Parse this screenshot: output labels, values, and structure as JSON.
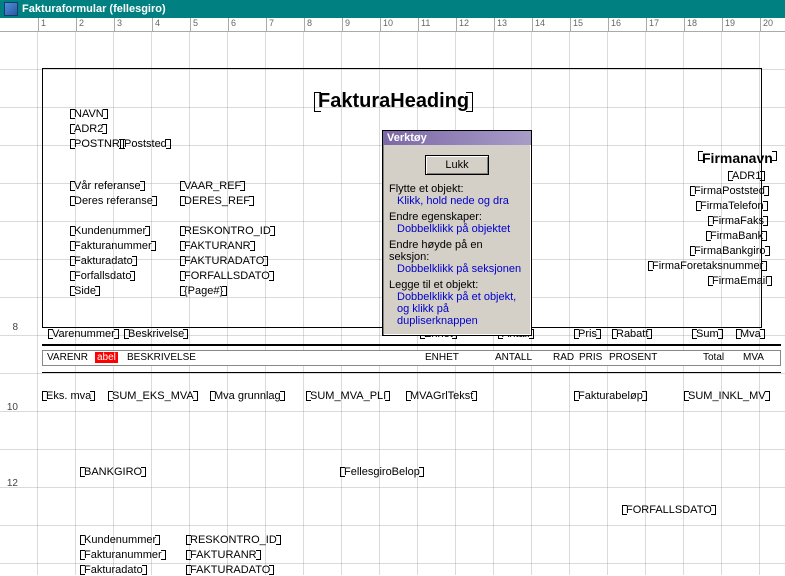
{
  "window": {
    "title": "Fakturaformular (fellesgiro)"
  },
  "ruler": [
    "1",
    "2",
    "3",
    "4",
    "5",
    "6",
    "7",
    "8",
    "9",
    "10",
    "11",
    "12",
    "13",
    "14",
    "15",
    "16",
    "17",
    "18",
    "19",
    "20"
  ],
  "left_nums": {
    "n8": "8",
    "n10": "10",
    "n12": "12"
  },
  "heading": "FakturaHeading",
  "addr": {
    "navn": "NAVN",
    "adr2": "ADR2",
    "postnr": "POSTNR",
    "poststed": "Poststed"
  },
  "refs": {
    "var_ref_lbl": "Vår referanse",
    "var_ref": "VAAR_REF",
    "deres_ref_lbl": "Deres referanse",
    "deres_ref": "DERES_REF"
  },
  "info": {
    "kundenr_lbl": "Kundenummer",
    "kundenr": "RESKONTRO_ID",
    "fakturanr_lbl": "Fakturanummer",
    "fakturanr": "FAKTURANR",
    "fakturadato_lbl": "Fakturadato",
    "fakturadato": "FAKTURADATO",
    "forfall_lbl": "Forfallsdato",
    "forfall": "FORFALLSDATO",
    "side_lbl": "Side",
    "side": "{Page#}"
  },
  "firma": {
    "navn": "Firmanavn",
    "adr1": "ADR1",
    "poststed": "FirmaPoststed",
    "telefon": "FirmaTelefon",
    "faks": "FirmaFaks",
    "bank": "FirmaBank",
    "bankgiro": "FirmaBankgiro",
    "foretak": "FirmaForetaksnummer",
    "email": "FirmaEmail"
  },
  "cols": {
    "varenr": "Varenummer",
    "beskrivelse": "Beskrivelse",
    "enhet": "Enhet",
    "antall": "Antall",
    "pris": "Pris",
    "rabatt": "Rabatt",
    "sum": "Sum",
    "mva": "Mva"
  },
  "detail": {
    "varenr": "VARENR",
    "label": "abel",
    "beskrivelse": "BESKRIVELSE",
    "enhet": "ENHET",
    "antall": "ANTALL",
    "rad": "RAD",
    "pris": "PRIS",
    "prosent": "PROSENT",
    "total": "Total",
    "mva": "MVA"
  },
  "totals": {
    "eks_lbl": "Eks. mva",
    "eks": "SUM_EKS_MVA",
    "grunnlag_lbl": "Mva grunnlag",
    "grunnlag": "SUM_MVA_PLI",
    "mvagrl": "MVAGrlTekst",
    "belop_lbl": "Fakturabeløp",
    "belop": "SUM_INKL_MV"
  },
  "giro": {
    "bankgiro": "BANKGIRO",
    "belop": "FellesgiroBelop",
    "forfall": "FORFALLSDATO",
    "kundenr_lbl": "Kundenummer",
    "kundenr": "RESKONTRO_ID",
    "fakturanr_lbl": "Fakturanummer",
    "fakturanr": "FAKTURANR",
    "fakturadato_lbl": "Fakturadato",
    "fakturadato": "FAKTURADATO"
  },
  "toolbox": {
    "title": "Verktøy",
    "close": "Lukk",
    "h1": "Flytte et objekt:",
    "a1": "Klikk, hold nede og dra",
    "h2": "Endre egenskaper:",
    "a2": "Dobbelklikk på objektet",
    "h3": "Endre høyde på en seksjon:",
    "a3": "Dobbelklikk på seksjonen",
    "h4": "Legge til et objekt:",
    "a4a": "Dobbelklikk på et objekt,",
    "a4b": "og klikk på dupliserknappen"
  }
}
